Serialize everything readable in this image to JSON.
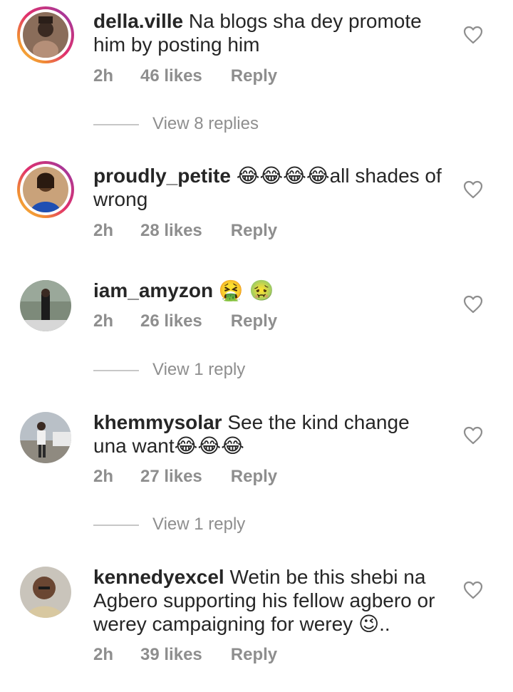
{
  "comments": [
    {
      "username": "della.ville",
      "text": "Na blogs sha dey promote him by posting him",
      "time": "2h",
      "likes": "46 likes",
      "reply": "Reply",
      "avatar_story_ring": true,
      "icon": "heart-outline-icon"
    },
    {
      "username": "proudly_petite",
      "text": "😂😂😂😂all shades of wrong",
      "time": "2h",
      "likes": "28 likes",
      "reply": "Reply",
      "avatar_story_ring": true,
      "icon": "heart-outline-icon"
    },
    {
      "username": "iam_amyzon",
      "text": "🤮 🤢",
      "time": "2h",
      "likes": "26 likes",
      "reply": "Reply",
      "avatar_story_ring": false,
      "icon": "heart-outline-icon"
    },
    {
      "username": "khemmysolar",
      "text": "See the kind change una want😂😂😂",
      "time": "2h",
      "likes": "27 likes",
      "reply": "Reply",
      "avatar_story_ring": false,
      "icon": "heart-outline-icon"
    },
    {
      "username": "kennedyexcel",
      "text": "Wetin be this shebi na Agbero supporting his fellow agbero or werey campaigning for werey 😉..",
      "time": "2h",
      "likes": "39 likes",
      "reply": "Reply",
      "avatar_story_ring": false,
      "icon": "heart-outline-icon"
    }
  ],
  "view_replies": [
    {
      "label": "View 8 replies"
    },
    {
      "label": "View 1 reply"
    },
    {
      "label": "View 1 reply"
    }
  ],
  "colors": {
    "text_primary": "#262626",
    "text_secondary": "#8e8e8e",
    "divider": "#c7c7c7",
    "story_ring_gradient": [
      "#f9c53a",
      "#e1306c",
      "#833ab4"
    ]
  }
}
